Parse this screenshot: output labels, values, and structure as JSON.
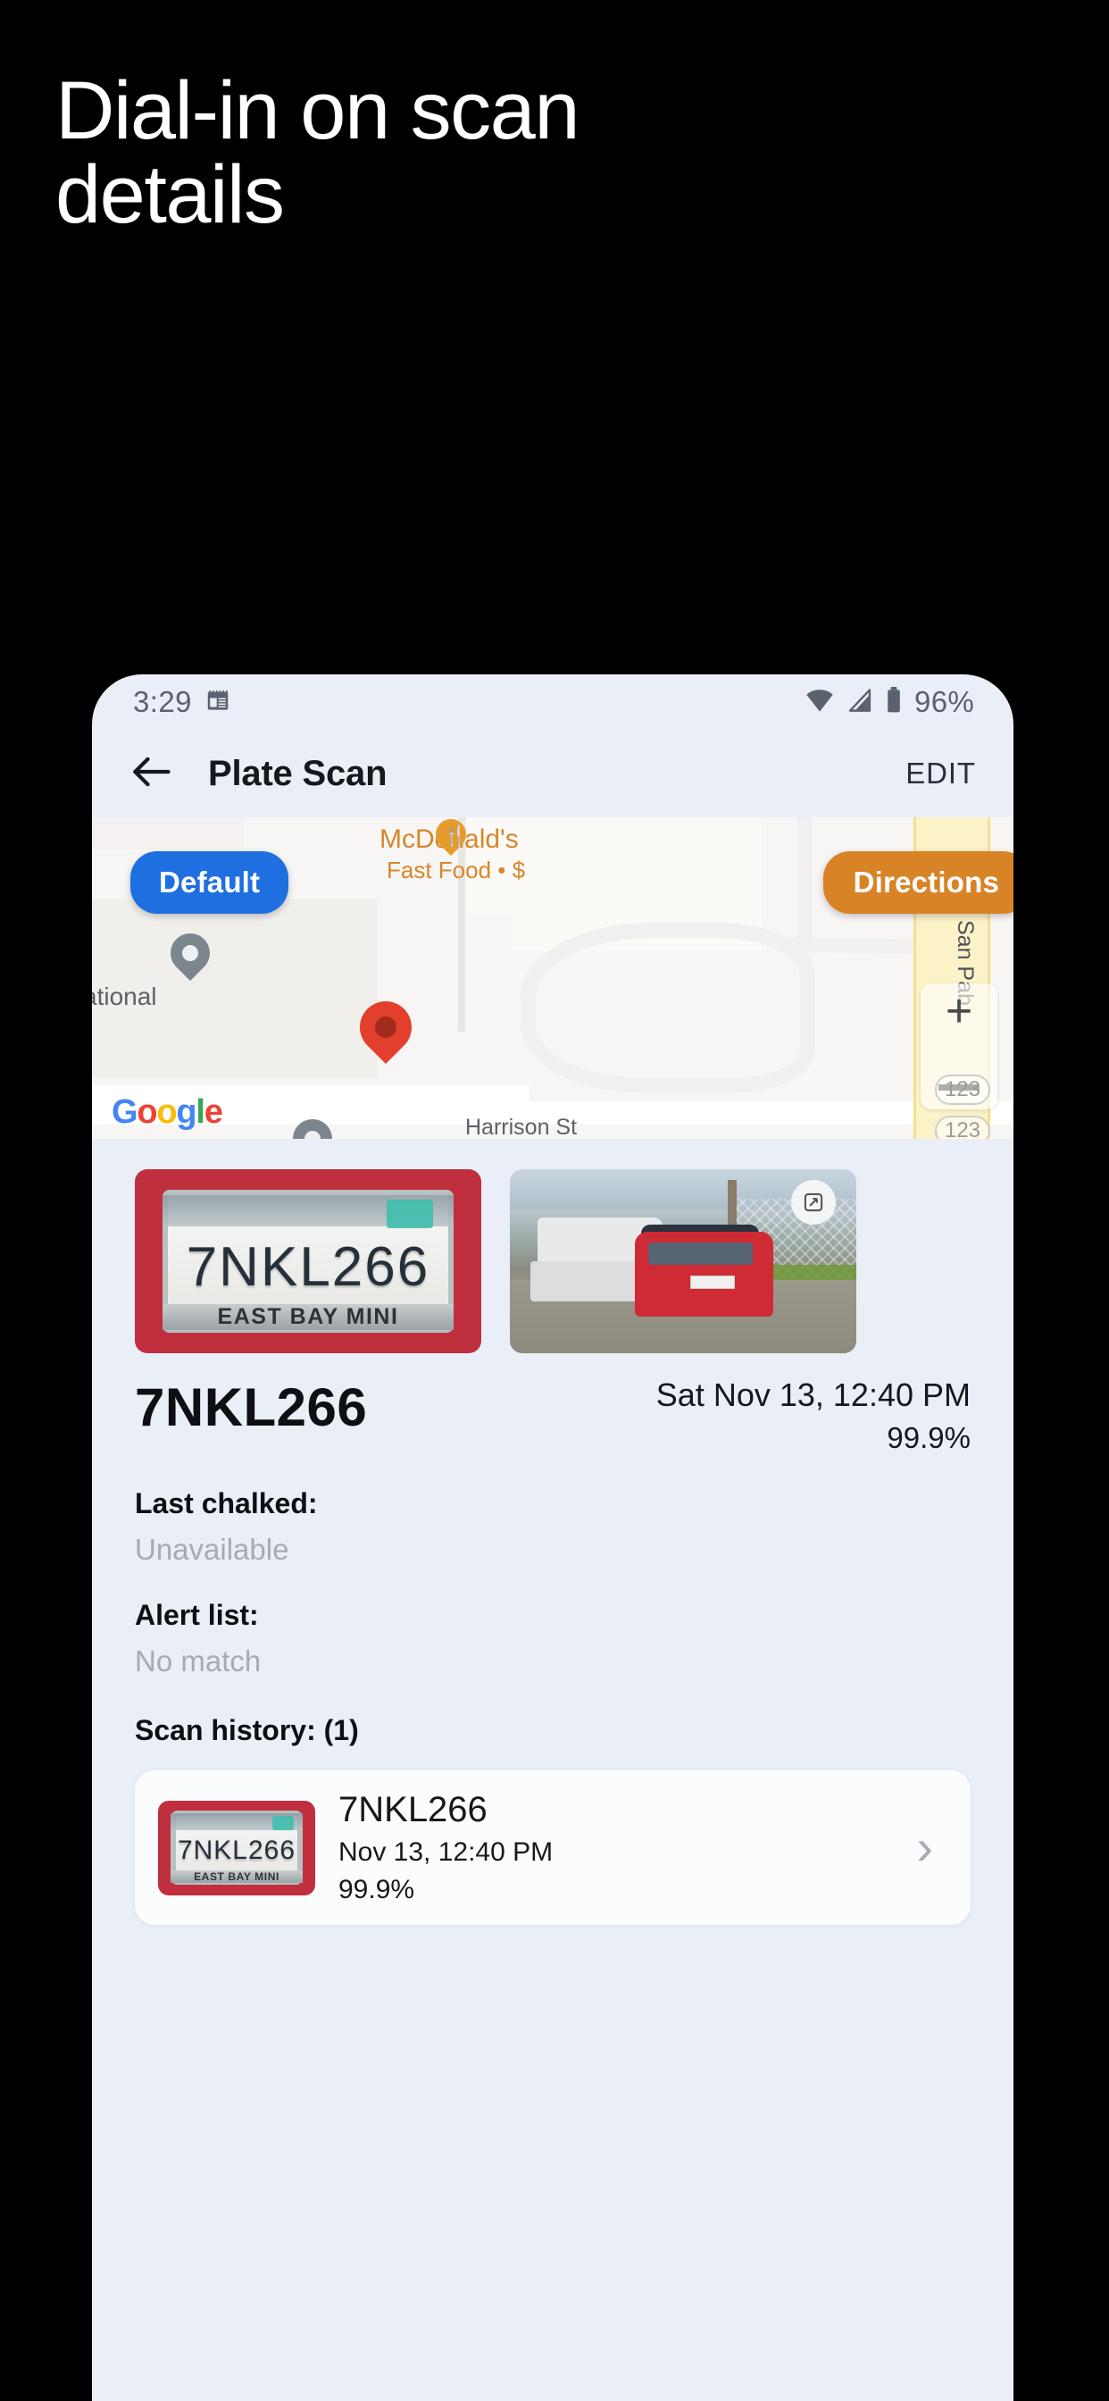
{
  "hero": {
    "headline": "Dial-in on scan\ndetails"
  },
  "phone": {
    "statusbar": {
      "time": "3:29",
      "calendar_icon": "calendar-icon",
      "wifi_icon": "wifi-icon",
      "signal_icon": "cell-signal-icon",
      "battery_icon": "battery-icon",
      "battery_text": "96%"
    },
    "appbar": {
      "back_icon": "arrow-left-icon",
      "title": "Plate Scan",
      "edit_label": "EDIT"
    },
    "map": {
      "default_button": "Default",
      "directions_button": "Directions",
      "labels": {
        "poi_name": "McDonald's",
        "poi_sub": "Fast Food • $",
        "street_harrison": "Harrison St",
        "street_sanpablo": "San Pab",
        "place_partial": "ational"
      },
      "zoom_in": "+",
      "zoom_out": "−",
      "route_shield_1": "123",
      "route_shield_2": "123",
      "attribution": "Google",
      "attribution_letters": [
        "G",
        "o",
        "o",
        "g",
        "l",
        "e"
      ],
      "marker_main": "map-pin-red",
      "marker_other_1": "map-pin-grey",
      "marker_other_2": "map-pin-grey"
    },
    "scan": {
      "plate_image_alt": "license-plate-photo",
      "plate_image_text": "7NKL266",
      "plate_frame_text": "EAST BAY MINI",
      "vehicle_image_alt": "vehicle-photo",
      "plate_number": "7NKL266",
      "timestamp": "Sat Nov 13, 12:40 PM",
      "confidence": "99.9%",
      "fields": [
        {
          "label": "Last chalked:",
          "value": "Unavailable"
        },
        {
          "label": "Alert list:",
          "value": "No match"
        }
      ],
      "history_title": "Scan history: (1)",
      "history": [
        {
          "thumb_text": "7NKL266",
          "thumb_sub": "EAST BAY MINI",
          "plate": "7NKL266",
          "date": "Nov 13, 12:40 PM",
          "confidence": "99.9%",
          "chevron": "›"
        }
      ]
    }
  },
  "colors": {
    "background": "#000000",
    "phone_bg": "#eaeff7",
    "accent_blue": "#1e6fe0",
    "accent_orange": "#d98327",
    "pin_red": "#e2402c",
    "muted_text": "#a6abb3"
  }
}
